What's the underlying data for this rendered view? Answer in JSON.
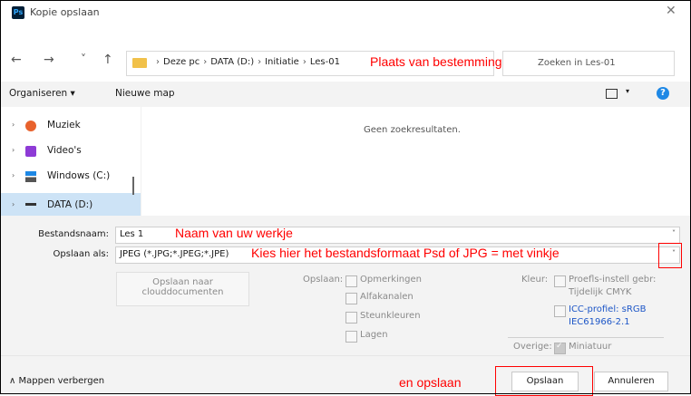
{
  "window": {
    "title": "Kopie opslaan",
    "app_icon_text": "Ps",
    "close_glyph": "✕"
  },
  "nav": {
    "back": "←",
    "forward": "→",
    "recent": "˅",
    "up": "↑",
    "breadcrumb": [
      "Deze pc",
      "DATA (D:)",
      "Initiatie",
      "Les-01"
    ],
    "crumb_sep": "›",
    "search_placeholder": "Zoeken in Les-01"
  },
  "toolbar": {
    "organize": "Organiseren ▾",
    "new_folder": "Nieuwe map",
    "view_caret": "▾",
    "help": "?"
  },
  "sidebar": {
    "items": [
      {
        "label": "Muziek",
        "icon": "music-icon",
        "color": "#e8622d"
      },
      {
        "label": "Video's",
        "icon": "video-icon",
        "color": "#8e3bd6"
      },
      {
        "label": "Windows (C:)",
        "icon": "windows-drive-icon",
        "color": "#1e88e5"
      },
      {
        "label": "DATA (D:)",
        "icon": "drive-icon",
        "color": "#333333",
        "selected": true
      }
    ],
    "chevron": "›"
  },
  "results": {
    "empty_text": "Geen zoekresultaten."
  },
  "form": {
    "filename_label": "Bestandsnaam:",
    "filename_value": "Les 1",
    "type_label": "Opslaan als:",
    "type_value": "JPEG (*.JPG;*.JPEG;*.JPE)",
    "caret": "˅"
  },
  "options": {
    "cloud_button": [
      "Opslaan naar",
      "clouddocumenten"
    ],
    "save_label": "Opslaan:",
    "save_options": [
      "Opmerkingen",
      "Alfakanalen",
      "Steunkleuren",
      "Lagen"
    ],
    "color_label": "Kleur:",
    "proof_line1": "Proefls-instell gebr:",
    "proof_line2": "Tijdelijk CMYK",
    "icc_line1": "ICC-profiel:  sRGB",
    "icc_line2": "IEC61966-2.1",
    "other_label": "Overige:",
    "thumbnail": "Miniatuur"
  },
  "footer": {
    "hide_folders": "∧  Mappen verbergen",
    "save_button": "Opslaan",
    "cancel_button": "Annuleren"
  },
  "annotations": {
    "destination": "Plaats van bestemming",
    "name": "Naam van uw werkje",
    "format": "Kies hier het bestandsformaat Psd of JPG = met vinkje",
    "save": "en opslaan",
    "color": "#ff0000"
  }
}
